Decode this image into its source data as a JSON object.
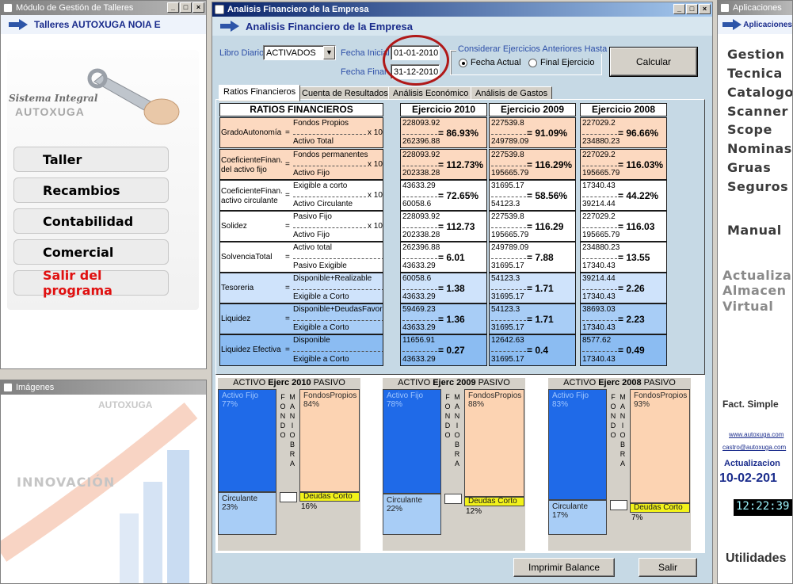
{
  "left_window": {
    "title": "Módulo de Gestión de Talleres",
    "header": "Talleres AUTOXUGA NOIA E",
    "logo_line1": "Sistema Integral",
    "logo_line2": "AUTOXUGA",
    "menu": [
      "Taller",
      "Recambios",
      "Contabilidad",
      "Comercial",
      "Salir del programa"
    ]
  },
  "images_window": {
    "title": "Imágenes",
    "brand": "AUTOXUGA",
    "slogan": "INNOVACIÓN"
  },
  "main_window": {
    "title": "Analisis Financiero de la Empresa",
    "header": "Analisis Financiero de la Empresa",
    "libro_label": "Libro Diario",
    "libro_value": "ACTIVADOS",
    "fecha_inicial_label": "Fecha Inicial",
    "fecha_inicial": "01-01-2010",
    "fecha_final_label": "Fecha Final",
    "fecha_final": "31-12-2010",
    "group_title": "Considerar Ejercicios Anteriores Hasta",
    "radio_actual": "Fecha Actual",
    "radio_final": "Final Ejercicio",
    "calcular": "Calcular",
    "imprimir": "Imprimir Balance",
    "salir": "Salir",
    "tabs": [
      "Ratios Financieros",
      "Cuenta de Resultados",
      "Análisis Económico",
      "Análisis de Gastos"
    ],
    "ratios_header": "RATIOS FINANCIEROS",
    "x100": "x 100",
    "years": [
      "Ejercicio 2010",
      "Ejercicio 2009",
      "Ejercicio 2008"
    ],
    "rows": [
      {
        "name": "GradoAutonomía",
        "num": "Fondos Propios",
        "den": "Activo Total",
        "pct": true,
        "vals": [
          [
            "228093.92",
            "86.93%",
            "262396.88"
          ],
          [
            "227539.8",
            "91.09%",
            "249789.09"
          ],
          [
            "227029.2",
            "96.66%",
            "234880.23"
          ]
        ]
      },
      {
        "name": "CoeficienteFinan. del activo fijo",
        "num": "Fondos permanentes",
        "den": "Activo Fijo",
        "pct": true,
        "vals": [
          [
            "228093.92",
            "112.73%",
            "202338.28"
          ],
          [
            "227539.8",
            "116.29%",
            "195665.79"
          ],
          [
            "227029.2",
            "116.03%",
            "195665.79"
          ]
        ]
      },
      {
        "name": "CoeficienteFinan. activo circulante",
        "num": "Exigible a corto",
        "den": "Activo Circulante",
        "pct": true,
        "vals": [
          [
            "43633.29",
            "72.65%",
            "60058.6"
          ],
          [
            "31695.17",
            "58.56%",
            "54123.3"
          ],
          [
            "17340.43",
            "44.22%",
            "39214.44"
          ]
        ]
      },
      {
        "name": "Solidez",
        "num": "Pasivo Fijo",
        "den": "Activo Fijo",
        "pct": true,
        "vals": [
          [
            "228093.92",
            "112.73",
            "202338.28"
          ],
          [
            "227539.8",
            "116.29",
            "195665.79"
          ],
          [
            "227029.2",
            "116.03",
            "195665.79"
          ]
        ]
      },
      {
        "name": "SolvenciaTotal",
        "num": "Activo total",
        "den": "Pasivo Exigible",
        "pct": false,
        "vals": [
          [
            "262396.88",
            "6.01",
            "43633.29"
          ],
          [
            "249789.09",
            "7.88",
            "31695.17"
          ],
          [
            "234880.23",
            "13.55",
            "17340.43"
          ]
        ]
      },
      {
        "name": "Tesoreria",
        "num": "Disponible+Realizable",
        "den": "Exigible a Corto",
        "pct": false,
        "vals": [
          [
            "60058.6",
            "1.38",
            "43633.29"
          ],
          [
            "54123.3",
            "1.71",
            "31695.17"
          ],
          [
            "39214.44",
            "2.26",
            "17340.43"
          ]
        ]
      },
      {
        "name": "Liquidez",
        "num": "Disponible+DeudasFavor",
        "den": "Exigible a Corto",
        "pct": false,
        "vals": [
          [
            "59469.23",
            "1.36",
            "43633.29"
          ],
          [
            "54123.3",
            "1.71",
            "31695.17"
          ],
          [
            "38693.03",
            "2.23",
            "17340.43"
          ]
        ]
      },
      {
        "name": "Liquidez Efectiva",
        "num": "Disponible",
        "den": "Exigible a Corto",
        "pct": false,
        "vals": [
          [
            "11656.91",
            "0.27",
            "43633.29"
          ],
          [
            "12642.63",
            "0.4",
            "31695.17"
          ],
          [
            "8577.62",
            "0.49",
            "17340.43"
          ]
        ]
      }
    ],
    "balances": [
      {
        "activo": "ACTIVO",
        "ejerc": "Ejerc 2010",
        "pasivo": "PASIVO",
        "af_label": "Activo Fijo",
        "af": "77%",
        "ci_label": "Circulante",
        "ci": "23%",
        "fp_label": "FondosPropios",
        "fp": "84%",
        "dc_label": "Deudas Corto",
        "dc": "16%",
        "fm": "FONDO",
        "mb": "MANIOBRA"
      },
      {
        "activo": "ACTIVO",
        "ejerc": "Ejerc 2009",
        "pasivo": "PASIVO",
        "af_label": "Activo Fijo",
        "af": "78%",
        "ci_label": "Circulante",
        "ci": "22%",
        "fp_label": "FondosPropios",
        "fp": "88%",
        "dc_label": "Deudas Corto",
        "dc": "12%",
        "fm": "FONDO",
        "mb": "MANIOBRA"
      },
      {
        "activo": "ACTIVO",
        "ejerc": "Ejerc 2008",
        "pasivo": "PASIVO",
        "af_label": "Activo Fijo",
        "af": "83%",
        "ci_label": "Circulante",
        "ci": "17%",
        "fp_label": "FondosPropios",
        "fp": "93%",
        "dc_label": "Deudas Corto",
        "dc": "7%",
        "fm": "FONDO",
        "mb": "MANIOBRA"
      }
    ]
  },
  "right_window": {
    "title": "Aplicaciones",
    "header": "Aplicaciones",
    "links": [
      "Gestion",
      "Tecnica",
      "Catalogo",
      "Scanner",
      "Scope",
      "Nominas",
      "Gruas",
      "Seguros"
    ],
    "manual": "Manual",
    "actualizar": [
      "Actualizar",
      "Almacen",
      "Virtual"
    ],
    "fact": "Fact. Simple",
    "web": "www.autoxuga.com",
    "email": "castro@autoxuga.com",
    "upd_label": "Actualizacion",
    "upd_date": "10-02-201",
    "clock": "12:22:39",
    "utilidades": "Utilidades"
  },
  "colors": {
    "row_orange": "#fcd9c0",
    "row_white": "#ffffff",
    "row_blue_light": "#cfe3fb",
    "row_blue": "#a8cdf6",
    "row_blue_dark": "#8bbcf2",
    "activo_fijo": "#1f6ae8",
    "circulante": "#a8cdf6",
    "fondos": "#fcd3b2",
    "deudas": "#f2f21a",
    "accent": "#2d4fa8"
  }
}
